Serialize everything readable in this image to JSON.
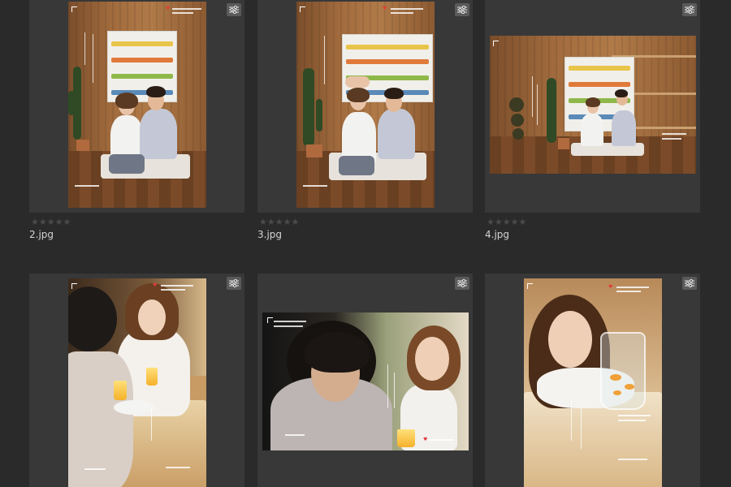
{
  "gallery": {
    "items": [
      {
        "filename": "2.jpg",
        "rating": "★★★★★",
        "settings_icon": "sliders-icon"
      },
      {
        "filename": "3.jpg",
        "rating": "★★★★★",
        "settings_icon": "sliders-icon"
      },
      {
        "filename": "4.jpg",
        "rating": "★★★★★",
        "settings_icon": "sliders-icon"
      },
      {
        "filename": "",
        "rating": "",
        "settings_icon": "sliders-icon"
      },
      {
        "filename": "",
        "rating": "",
        "settings_icon": "sliders-icon"
      },
      {
        "filename": "",
        "rating": "",
        "settings_icon": "sliders-icon"
      }
    ]
  },
  "colors": {
    "background": "#2a2a2a",
    "panel": "#383838",
    "filename_text": "#d4d4d4",
    "star_inactive": "#4b4b4b",
    "settings_button": "#5a5a5a"
  }
}
